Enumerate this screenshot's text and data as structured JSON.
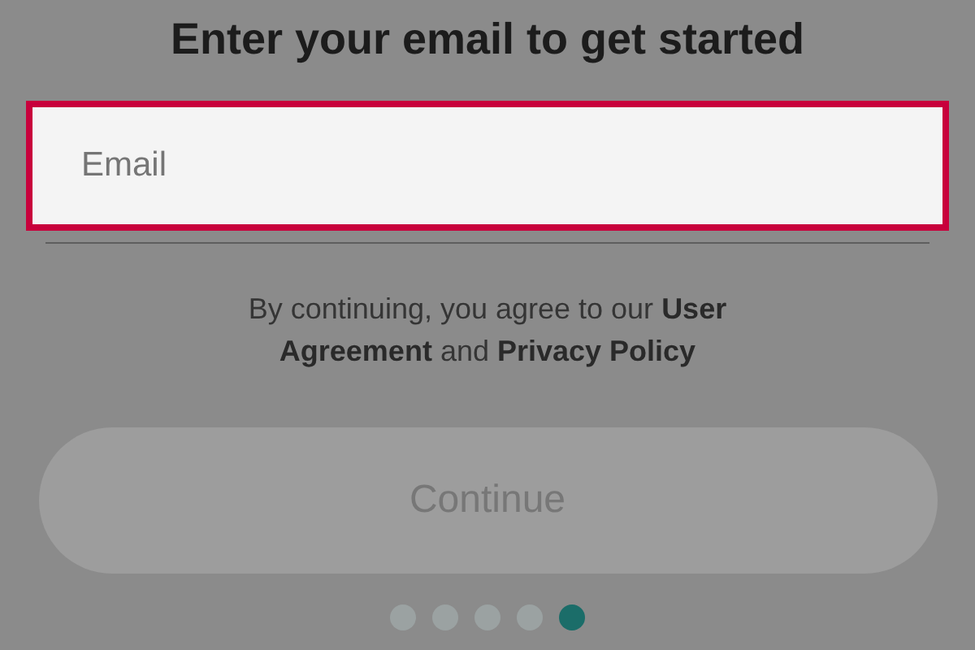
{
  "title": "Enter your email to get started",
  "email_field": {
    "placeholder": "Email"
  },
  "terms": "By continuing, you agree to our **User Agreement** and **Privacy Policy**",
  "continue_button": {
    "label": "Continue",
    "disabled": true
  },
  "pager": [
    {
      "selected": false
    },
    {
      "selected": false
    },
    {
      "selected": false
    },
    {
      "selected": false
    },
    {
      "selected": true
    }
  ]
}
